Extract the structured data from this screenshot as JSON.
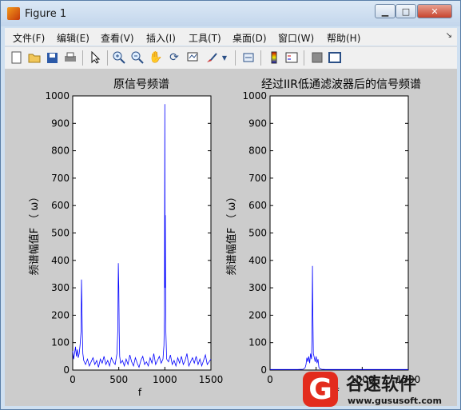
{
  "window": {
    "title": "Figure 1"
  },
  "menu": [
    "文件(F)",
    "编辑(E)",
    "查看(V)",
    "插入(I)",
    "工具(T)",
    "桌面(D)",
    "窗口(W)",
    "帮助(H)"
  ],
  "toolbar": {
    "icons": [
      "new-figure-icon",
      "open-file-icon",
      "save-icon",
      "print-icon",
      "arrow-pointer-icon",
      "zoom-in-icon",
      "zoom-out-icon",
      "pan-hand-icon",
      "rotate-3d-icon",
      "data-cursor-icon",
      "brush-icon",
      "dropdown-icon",
      "link-plot-icon",
      "colorbar-icon",
      "legend-icon",
      "hide-plot-tools-icon",
      "show-plot-tools-icon"
    ]
  },
  "plots": {
    "left": {
      "title": "原信号频谱",
      "ylabel": "频谱幅值F （ ω）",
      "xlabel": "f",
      "yticks": [
        "0",
        "100",
        "200",
        "300",
        "400",
        "500",
        "600",
        "700",
        "800",
        "900",
        "1000"
      ],
      "xticks": [
        "0",
        "500",
        "1000",
        "1500"
      ]
    },
    "right": {
      "title": "经过IIR低通滤波器后的信号频谱",
      "ylabel": "频谱幅值F （ ω）",
      "xlabel": "f",
      "yticks": [
        "0",
        "100",
        "200",
        "300",
        "400",
        "500",
        "600",
        "700",
        "800",
        "900",
        "1000"
      ],
      "xticks": [
        "0",
        "500",
        "1000",
        "1500"
      ]
    }
  },
  "watermark": {
    "logo": "G",
    "brand": "谷速软件",
    "url": "www.gususoft.com"
  },
  "chart_data": [
    {
      "type": "line",
      "title": "原信号频谱",
      "xlabel": "f",
      "ylabel": "频谱幅值F （ ω）",
      "xlim": [
        0,
        1500
      ],
      "ylim": [
        0,
        1000
      ],
      "series": [
        {
          "x": [
            0,
            10,
            20,
            30,
            40,
            50,
            60,
            70,
            80,
            90,
            95,
            100,
            105,
            110,
            120,
            140,
            160,
            180,
            200,
            220,
            240,
            260,
            280,
            300,
            320,
            340,
            360,
            380,
            400,
            420,
            440,
            460,
            480,
            490,
            495,
            500,
            505,
            510,
            520,
            540,
            560,
            580,
            600,
            620,
            640,
            660,
            680,
            700,
            720,
            740,
            760,
            780,
            800,
            820,
            840,
            860,
            880,
            900,
            920,
            940,
            960,
            980,
            990,
            995,
            1000,
            1002,
            1005,
            1010,
            1020,
            1040,
            1060,
            1080,
            1100,
            1120,
            1140,
            1160,
            1180,
            1200,
            1220,
            1240,
            1260,
            1280,
            1300,
            1320,
            1340,
            1360,
            1380,
            1400,
            1420,
            1440,
            1460,
            1480,
            1500
          ],
          "y": [
            70,
            40,
            60,
            85,
            50,
            75,
            45,
            60,
            90,
            140,
            330,
            240,
            130,
            60,
            35,
            20,
            40,
            15,
            30,
            45,
            20,
            35,
            10,
            40,
            25,
            50,
            20,
            35,
            15,
            45,
            30,
            20,
            60,
            150,
            390,
            300,
            140,
            50,
            25,
            35,
            15,
            40,
            20,
            55,
            30,
            15,
            45,
            25,
            10,
            35,
            50,
            20,
            30,
            15,
            45,
            25,
            60,
            20,
            35,
            50,
            25,
            40,
            90,
            200,
            970,
            300,
            565,
            150,
            40,
            30,
            55,
            20,
            35,
            15,
            45,
            25,
            50,
            20,
            35,
            60,
            15,
            30,
            45,
            25,
            50,
            20,
            40,
            15,
            35,
            55,
            20,
            30,
            40
          ]
        }
      ]
    },
    {
      "type": "line",
      "title": "经过IIR低通滤波器后的信号频谱",
      "xlabel": "f",
      "ylabel": "频谱幅值F （ ω）",
      "xlim": [
        0,
        1500
      ],
      "ylim": [
        0,
        1000
      ],
      "series": [
        {
          "x": [
            0,
            100,
            200,
            300,
            360,
            380,
            390,
            400,
            410,
            420,
            430,
            440,
            450,
            455,
            460,
            462,
            465,
            470,
            480,
            490,
            500,
            510,
            520,
            530,
            540,
            560,
            600,
            700,
            800,
            900,
            1000,
            1100,
            1200,
            1300,
            1400,
            1500
          ],
          "y": [
            2,
            2,
            2,
            2,
            3,
            8,
            20,
            45,
            30,
            50,
            25,
            60,
            40,
            120,
            380,
            300,
            200,
            60,
            45,
            30,
            50,
            25,
            40,
            10,
            5,
            3,
            2,
            2,
            2,
            2,
            2,
            2,
            2,
            2,
            2,
            2
          ]
        }
      ]
    }
  ]
}
